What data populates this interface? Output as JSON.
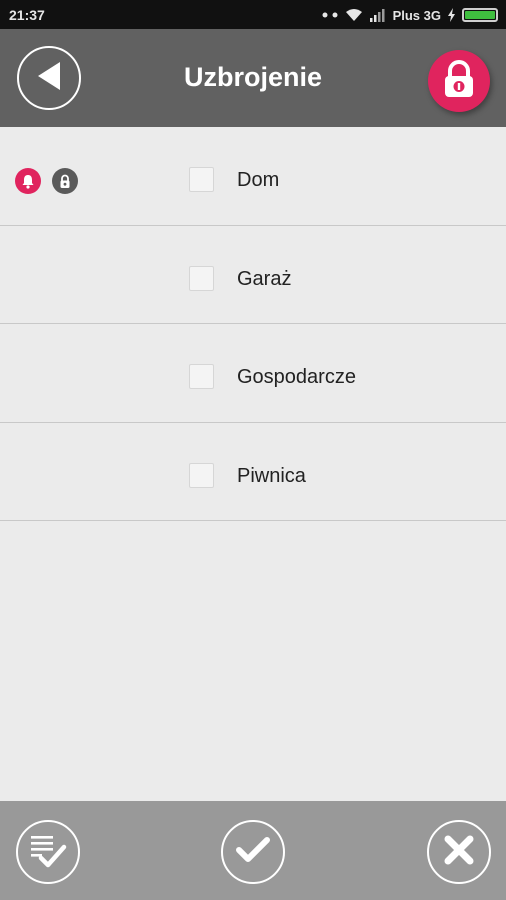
{
  "status_bar": {
    "time": "21:37",
    "network": "Plus 3G",
    "battery_level": 1.0
  },
  "header": {
    "title": "Uzbrojenie",
    "back_icon": "back-arrow-icon",
    "lock_icon": "padlock-icon",
    "accent_color": "#e0245e"
  },
  "zones": [
    {
      "label": "Dom",
      "checked": false,
      "alarm_indicator": true,
      "lock_indicator": true
    },
    {
      "label": "Garaż",
      "checked": false,
      "alarm_indicator": false,
      "lock_indicator": false
    },
    {
      "label": "Gospodarcze",
      "checked": false,
      "alarm_indicator": false,
      "lock_indicator": false
    },
    {
      "label": "Piwnica",
      "checked": false,
      "alarm_indicator": false,
      "lock_indicator": false
    }
  ],
  "footer": {
    "buttons": [
      "select-all-icon",
      "confirm-check-icon",
      "cancel-x-icon"
    ]
  }
}
